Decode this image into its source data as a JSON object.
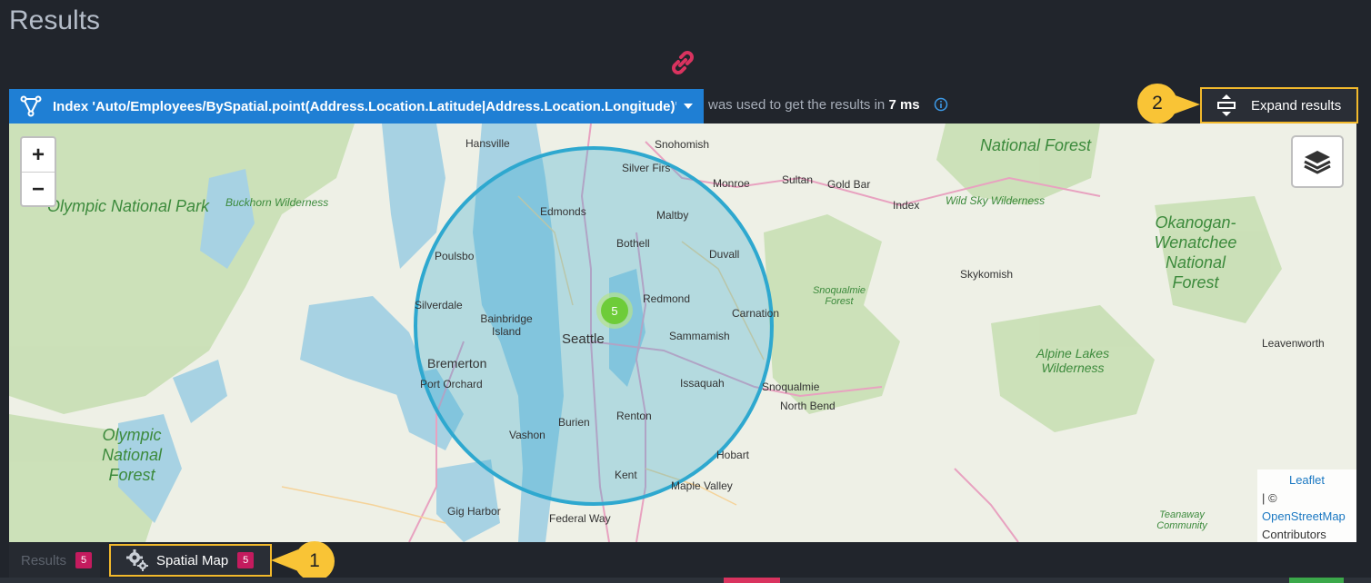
{
  "header": {
    "title": "Results"
  },
  "index_bar": {
    "label": "Index 'Auto/Employees/BySpatial.point(Address.Location.Latitude|Address.Location.Longitude)'",
    "used_text": "was used to get the results in",
    "time": "7 ms"
  },
  "callouts": {
    "one": "1",
    "two": "2"
  },
  "expand": {
    "label": "Expand results"
  },
  "map": {
    "zoom_in": "+",
    "zoom_out": "−",
    "cluster_count": "5",
    "attribution": {
      "leaflet": "Leaflet",
      "sep": "| ©",
      "osm": "OpenStreetMap",
      "contributors": "Contributors"
    },
    "places": [
      "Hansville",
      "Snohomish",
      "Silver Firs",
      "Monroe",
      "Sultan",
      "Gold Bar",
      "Index",
      "Edmonds",
      "Maltby",
      "Bothell",
      "Duvall",
      "Poulsbo",
      "Skykomish",
      "Silverdale",
      "Redmond",
      "Carnation",
      "Bainbridge Island",
      "Seattle",
      "Sammamish",
      "Bremerton",
      "Port Orchard",
      "Issaquah",
      "Snoqualmie",
      "North Bend",
      "Leavenworth",
      "Burien",
      "Renton",
      "Vashon",
      "Hobart",
      "Kent",
      "Maple Valley",
      "Gig Harbor",
      "Federal Way"
    ],
    "parks": [
      "Olympic National Park",
      "Buckhorn Wilderness",
      "National Forest",
      "Wild Sky Wilderness",
      "Okanogan-Wenatchee National Forest",
      "Snoqualmie Forest",
      "Alpine Lakes Wilderness",
      "Olympic National Forest",
      "Teanaway Community"
    ]
  },
  "tabs": {
    "results": {
      "label": "Results",
      "count": "5"
    },
    "spatial": {
      "label": "Spatial Map",
      "count": "5"
    }
  },
  "colors": {
    "accent": "#1f7fd4",
    "highlight": "#f2b92c",
    "count_badge": "#c41b5e",
    "circle": "#2ea8cf"
  }
}
